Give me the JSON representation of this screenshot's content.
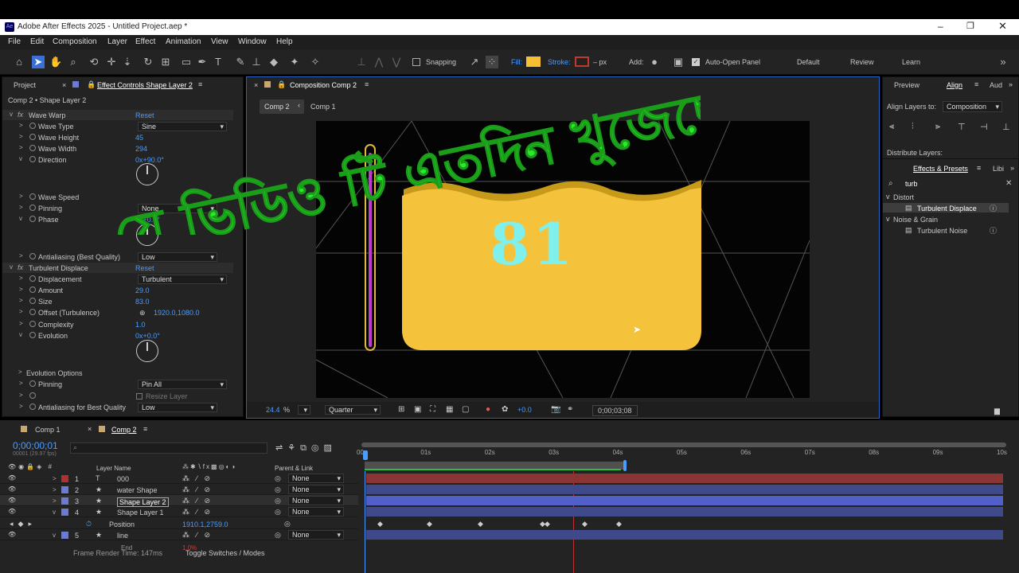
{
  "window": {
    "title": "Adobe After Effects 2025 - Untitled Project.aep *",
    "logo": "Ae"
  },
  "menu": [
    "File",
    "Edit",
    "Composition",
    "Layer",
    "Effect",
    "Animation",
    "View",
    "Window",
    "Help"
  ],
  "toolbar": {
    "snapping": "Snapping",
    "fill": "Fill:",
    "stroke": "Stroke:",
    "stroke_px": "– px",
    "add": "Add:",
    "auto_open": "Auto-Open Panel",
    "workspaces": [
      "Default",
      "Review",
      "Learn"
    ],
    "fill_color": "#f7c032",
    "stroke_color": "#c0392b"
  },
  "left_panel": {
    "tab_project": "Project",
    "tab_effect": "Effect Controls Shape Layer 2",
    "breadcrumb": "Comp 2 • Shape Layer 2",
    "rows": [
      {
        "name": "Wave Warp",
        "value": "Reset",
        "fx": true
      },
      {
        "name": "Wave Type",
        "value": "Sine",
        "dd": true
      },
      {
        "name": "Wave Height",
        "value": "45"
      },
      {
        "name": "Wave Width",
        "value": "294"
      },
      {
        "name": "Direction",
        "value": "0x+90.0°"
      },
      {
        "name": "Wave Speed",
        "value": ""
      },
      {
        "name": "Pinning",
        "value": "None",
        "dd": true
      },
      {
        "name": "Phase",
        "value": "0x+0.0°"
      },
      {
        "name": "Antialiasing (Best Quality)",
        "value": "Low",
        "dd": true
      },
      {
        "name": "Turbulent Displace",
        "value": "Reset",
        "fx": true
      },
      {
        "name": "Displacement",
        "value": "Turbulent",
        "dd": true
      },
      {
        "name": "Amount",
        "value": "29.0"
      },
      {
        "name": "Size",
        "value": "83.0"
      },
      {
        "name": "Offset (Turbulence)",
        "value": "1920.0,1080.0"
      },
      {
        "name": "Complexity",
        "value": "1.0"
      },
      {
        "name": "Evolution",
        "value": "0x+0.0°"
      },
      {
        "name": "Evolution Options",
        "value": ""
      },
      {
        "name": "Pinning",
        "value": "Pin All",
        "dd": true
      },
      {
        "name": "Resize Layer",
        "value": ""
      },
      {
        "name": "Antialiasing for Best Quality",
        "value": "Low",
        "dd": true
      }
    ]
  },
  "comp": {
    "tab": "Composition Comp 2",
    "crumbs": [
      "Comp 2",
      "Comp 1"
    ],
    "number": "81",
    "zoom": "24.4",
    "zoom_unit": "%",
    "quality": "Quarter",
    "exposure": "+0.0",
    "timecode": "0;00;03;08"
  },
  "overlay_text": "যে ভিডিও টি এতদিন খুজেছেন",
  "right_panel": {
    "tabs": [
      "Preview",
      "Align",
      "Aud"
    ],
    "align_layers_to": "Align Layers to:",
    "align_target": "Composition",
    "distribute": "Distribute Layers:",
    "effects_tab": "Effects & Presets",
    "lib_tab": "Libi",
    "search": "turb",
    "groups": [
      {
        "name": "Distort",
        "items": [
          "Turbulent Displace"
        ]
      },
      {
        "name": "Noise & Grain",
        "items": [
          "Turbulent Noise"
        ]
      }
    ]
  },
  "timeline": {
    "tabs": [
      "Comp 1",
      "Comp 2"
    ],
    "timecode": "0;00;00;01",
    "fps": "00001 (29.97 fps)",
    "col_layer": "Layer Name",
    "col_parent": "Parent & Link",
    "ruler": [
      "00s",
      "01s",
      "02s",
      "03s",
      "04s",
      "05s",
      "06s",
      "07s",
      "08s",
      "09s",
      "10s"
    ],
    "layers": [
      {
        "num": "1",
        "name": "000",
        "type": "T",
        "parent": "None",
        "color": "#b03030"
      },
      {
        "num": "2",
        "name": "water Shape",
        "type": "★",
        "parent": "None",
        "color": "#6a7bd6"
      },
      {
        "num": "3",
        "name": "Shape Layer 2",
        "type": "★",
        "parent": "None",
        "color": "#6a7bd6"
      },
      {
        "num": "4",
        "name": "Shape Layer 1",
        "type": "★",
        "parent": "None",
        "color": "#6a7bd6"
      },
      {
        "num": "",
        "name": "Position",
        "type": "",
        "parent": "",
        "color": ""
      },
      {
        "num": "5",
        "name": "line",
        "type": "★",
        "parent": "None",
        "color": "#6a7bd6"
      }
    ],
    "position_value": "1910.1,2759.0",
    "sub_row": "End",
    "sub_val": "1.0%",
    "footer_render": "Frame Render Time: 147ms",
    "footer_toggle": "Toggle Switches / Modes"
  }
}
